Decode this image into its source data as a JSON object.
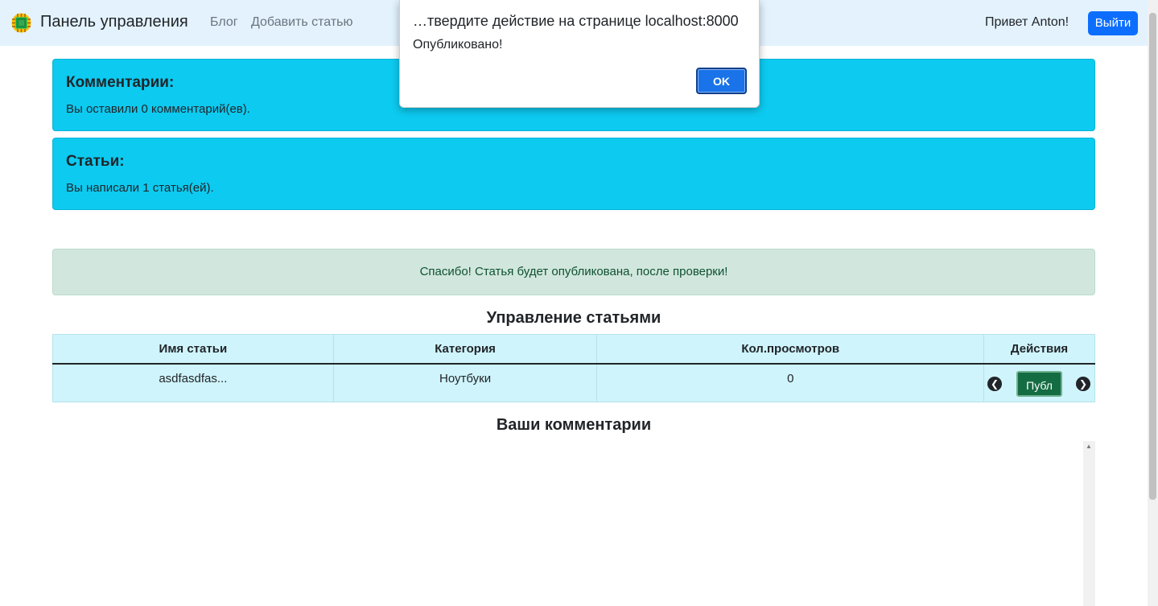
{
  "navbar": {
    "brand": "Панель управления",
    "links": [
      "Блог",
      "Добавить статью"
    ],
    "greeting": "Привет Anton!",
    "logout_label": "Выйти"
  },
  "cards": {
    "comments": {
      "title": "Комментарии:",
      "text": "Вы оставили 0 комментарий(ев)."
    },
    "articles": {
      "title": "Статьи:",
      "text": "Вы написали 1 статья(ей)."
    }
  },
  "alert": {
    "text": "Спасибо! Статья будет опубликована, после проверки!"
  },
  "articles_section": {
    "title": "Управление статьями",
    "columns": [
      "Имя статьи",
      "Категория",
      "Кол.просмотров",
      "Действия"
    ],
    "rows": [
      {
        "name": "asdfasdfas...",
        "category": "Ноутбуки",
        "views": "0",
        "action_label": "Публ"
      }
    ]
  },
  "comments_section": {
    "title": "Ваши комментарии"
  },
  "dialog": {
    "title": "…твердите действие на странице localhost:8000",
    "message": "Опубликовано!",
    "ok_label": "OK"
  },
  "colors": {
    "info": "#0dcaf0",
    "success_bg": "#d1e7dd",
    "primary": "#0d6efd",
    "navbar_bg": "#e3f2fd"
  }
}
